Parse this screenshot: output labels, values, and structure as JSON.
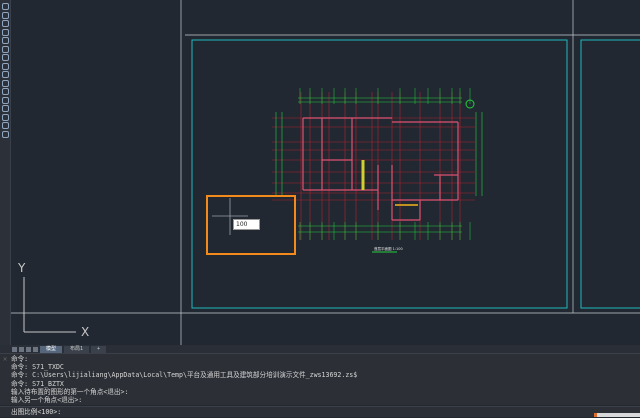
{
  "toolbar": {
    "icons": [
      "line-icon",
      "polyline-icon",
      "circle-icon",
      "rectangle-icon",
      "arc-icon",
      "ellipse-icon",
      "revcloud-icon",
      "spline-icon",
      "donut-icon",
      "insert-block-icon",
      "make-block-icon",
      "point-icon",
      "hatch-icon",
      "gradient-icon",
      "region-icon",
      "table-icon"
    ]
  },
  "layout_tabs": {
    "items": [
      {
        "label": "模型",
        "active": true
      },
      {
        "label": "布局1",
        "active": false
      }
    ]
  },
  "command_history": [
    "命令:",
    "命令: S71_TXDC",
    "命令: C:\\Users\\lijialiang\\AppData\\Local\\Temp\\平台及通用工具及建筑部分培训演示文件_zws13692.zs$",
    "命令: S71_BZTX",
    "输入待布置的图形的第一个角点<退出>:",
    "输入另一个角点<退出>:"
  ],
  "command_prompt": "出图比例<100>:",
  "dynamic_input": {
    "value": "100"
  },
  "ucs": {
    "x_label": "X",
    "y_label": "Y"
  },
  "drawing_title": "首层平面图 1:100",
  "colors": {
    "background": "#212831",
    "frame": "#1fb8c0",
    "selection": "#f28a1c",
    "wall": "#e05070",
    "grid": "#b02030",
    "dimension": "#22d040"
  }
}
